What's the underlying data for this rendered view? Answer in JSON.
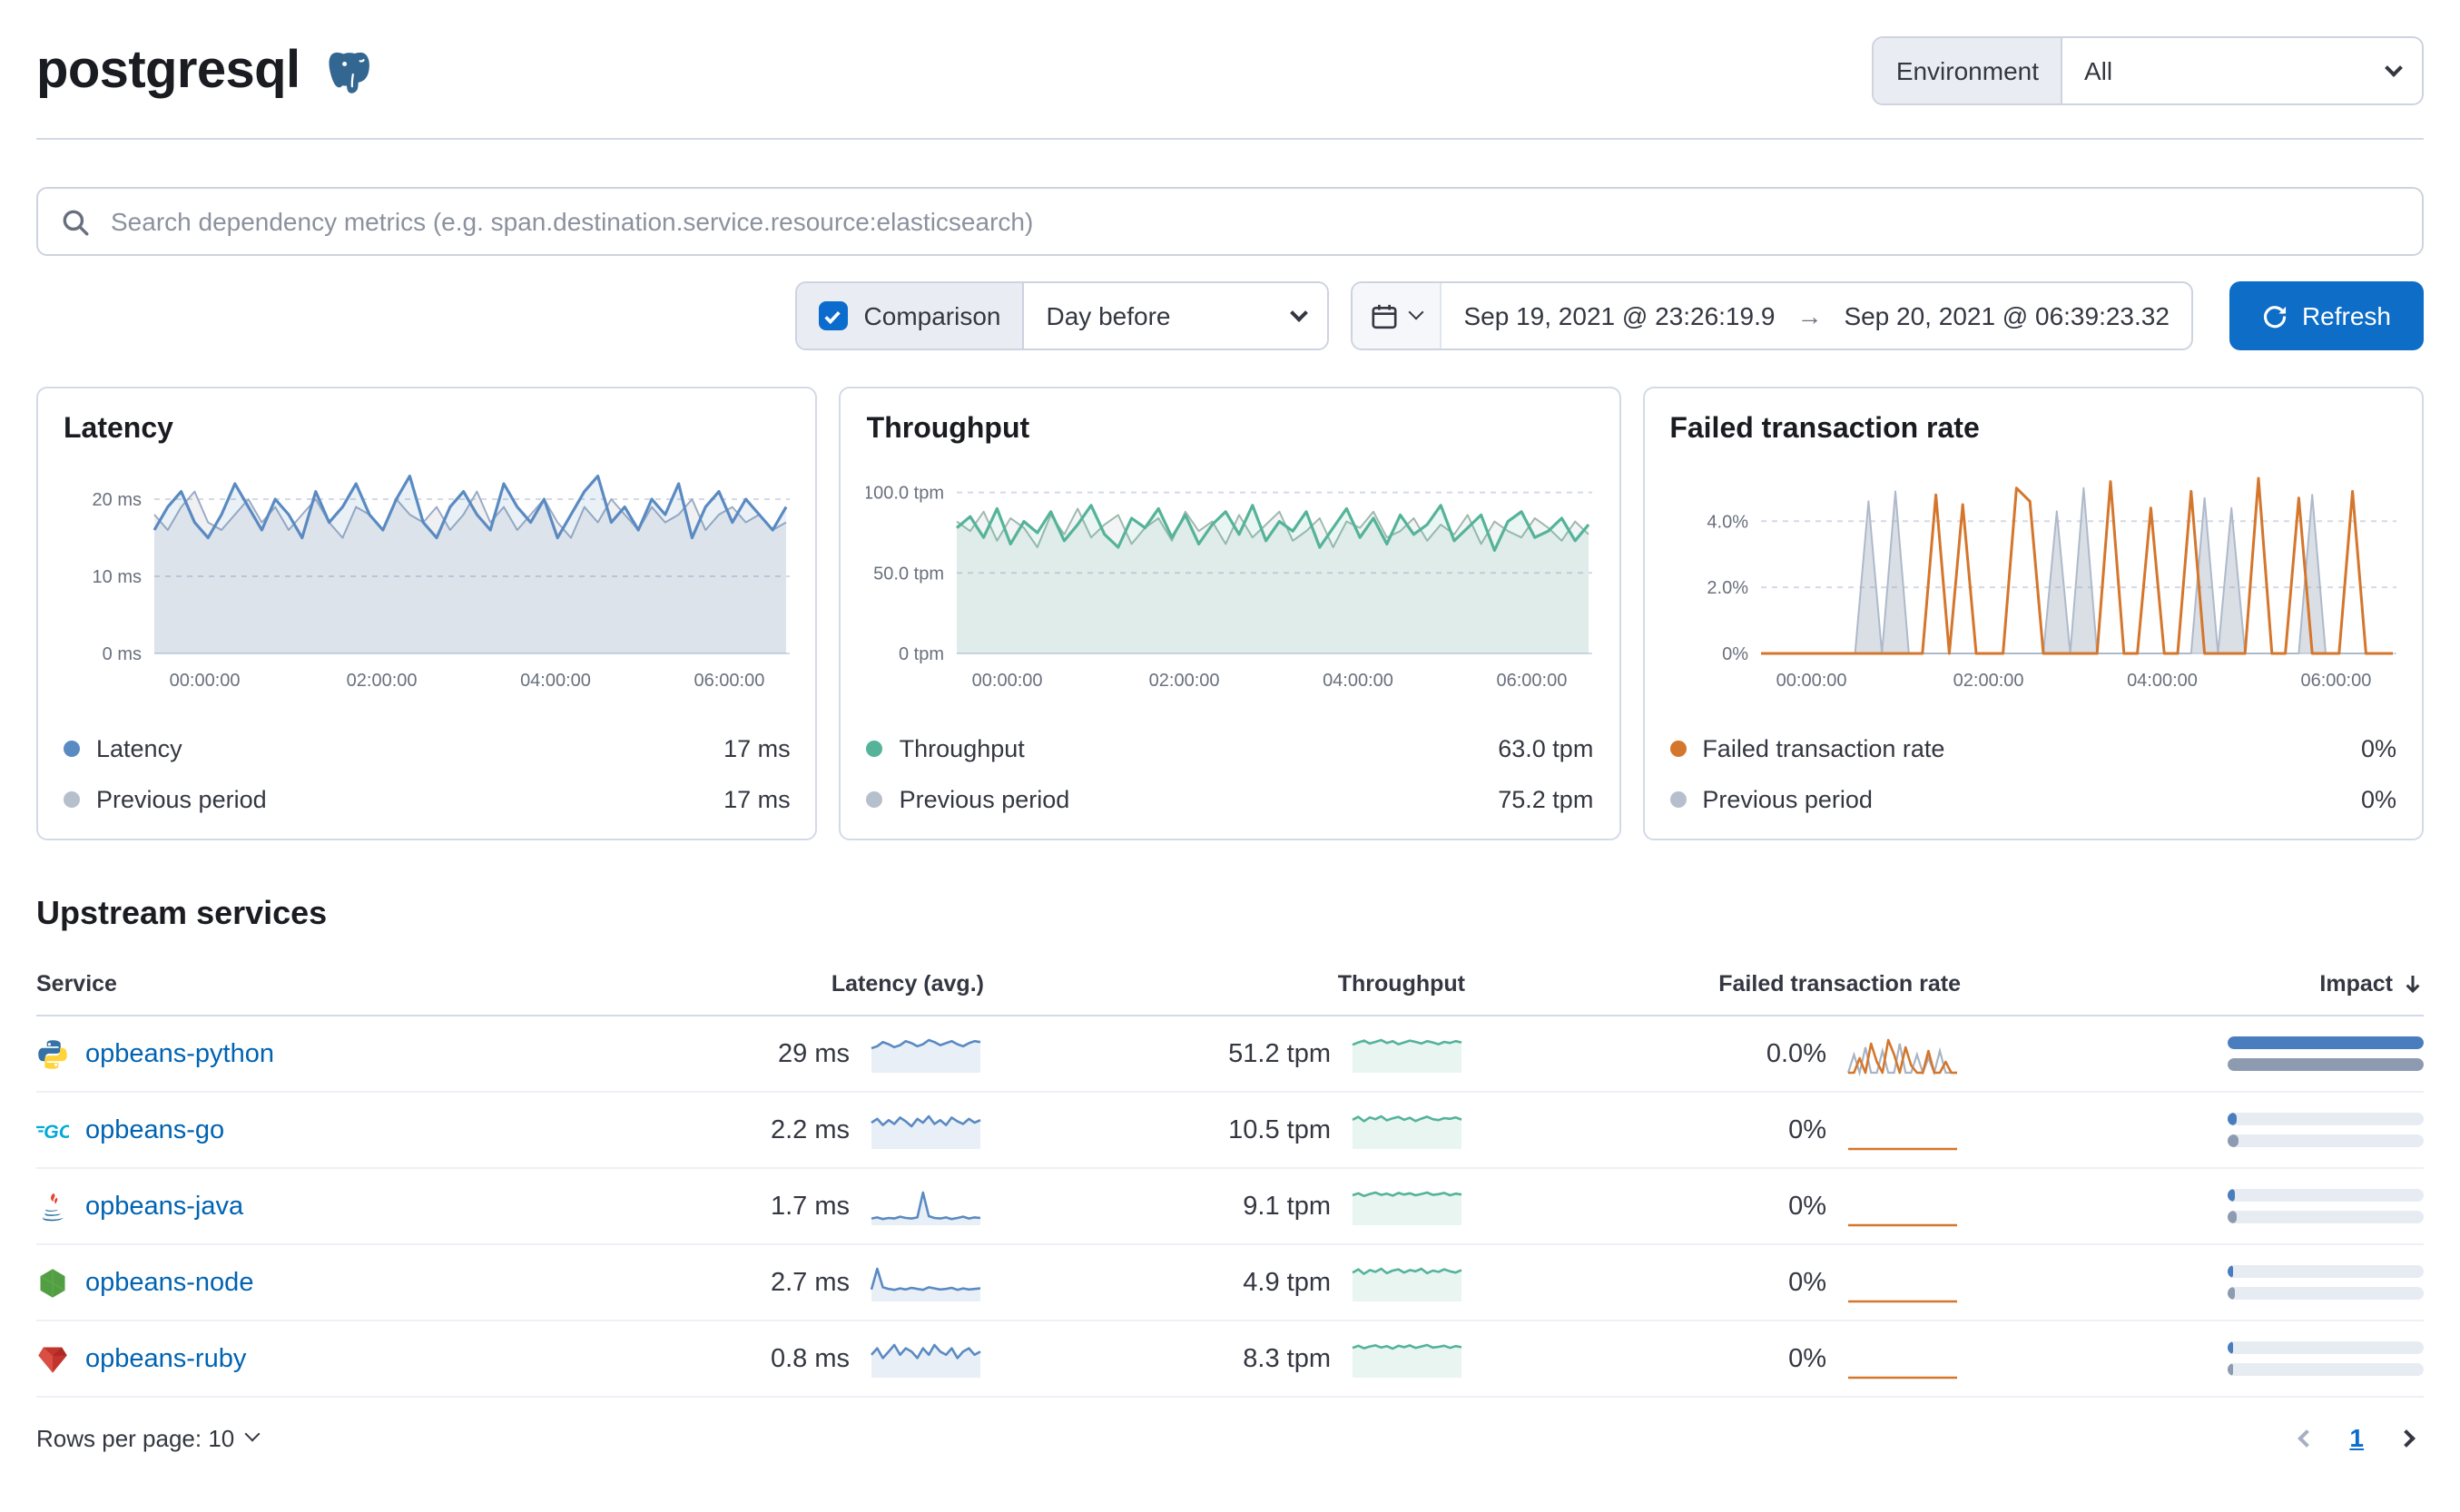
{
  "colors": {
    "accent": "#0b6cce",
    "link": "#0063b2",
    "latency": "#5a8ac2",
    "throughput": "#54b399",
    "failed": "#d4762c",
    "previous": "#a9b4c4",
    "impact_current": "#4a7dbd",
    "impact_previous": "#8d9bb1",
    "impact_track": "#e7ecf3"
  },
  "page": {
    "title": "postgresql"
  },
  "header": {
    "environment_label": "Environment",
    "environment_value": "All"
  },
  "search": {
    "placeholder": "Search dependency metrics (e.g. span.destination.service.resource:elasticsearch)"
  },
  "controls": {
    "comparison_label": "Comparison",
    "comparison_checked": true,
    "comparison_option": "Day before",
    "date_start": "Sep 19, 2021 @ 23:26:19.9",
    "date_end": "Sep 20, 2021 @ 06:39:23.32",
    "refresh_label": "Refresh"
  },
  "chart_data": [
    {
      "type": "line",
      "title": "Latency",
      "x_tick_labels": [
        "00:00:00",
        "02:00:00",
        "04:00:00",
        "06:00:00"
      ],
      "y": {
        "max": 24,
        "ticks": [
          {
            "value": 20,
            "label": "20 ms"
          },
          {
            "value": 10,
            "label": "10 ms"
          },
          {
            "value": 0,
            "label": "0 ms"
          }
        ]
      },
      "series": [
        {
          "name": "Latency",
          "color": "#5a8ac2",
          "width": 1.6,
          "fill": "rgba(96,146,192,0.14)",
          "values": [
            16,
            19,
            21,
            17,
            15,
            18,
            22,
            19,
            16,
            20,
            18,
            15,
            21,
            17,
            19,
            22,
            18,
            16,
            20,
            23,
            17,
            15,
            19,
            21,
            18,
            16,
            22,
            19,
            17,
            20,
            15,
            18,
            21,
            23,
            17,
            19,
            16,
            20,
            18,
            22,
            15,
            19,
            21,
            17,
            20,
            18,
            16,
            19
          ]
        },
        {
          "name": "Previous period",
          "color": "#9aabc4",
          "width": 1,
          "fill": "rgba(105,112,125,0.10)",
          "values": [
            18,
            16,
            19,
            21,
            17,
            16,
            18,
            20,
            17,
            19,
            16,
            18,
            20,
            17,
            15,
            19,
            18,
            16,
            20,
            18,
            17,
            19,
            16,
            18,
            21,
            17,
            19,
            16,
            18,
            20,
            17,
            15,
            19,
            17,
            20,
            18,
            16,
            19,
            17,
            18,
            20,
            16,
            18,
            19,
            17,
            18,
            16,
            17
          ]
        }
      ],
      "legend": [
        {
          "label": "Latency",
          "value": "17 ms",
          "color": "#5a8ac2"
        },
        {
          "label": "Previous period",
          "value": "17 ms",
          "color": "#b6bfcc"
        }
      ]
    },
    {
      "type": "line",
      "title": "Throughput",
      "x_tick_labels": [
        "00:00:00",
        "02:00:00",
        "04:00:00",
        "06:00:00"
      ],
      "y": {
        "max": 115,
        "ticks": [
          {
            "value": 100,
            "label": "100.0 tpm"
          },
          {
            "value": 50,
            "label": "50.0 tpm"
          },
          {
            "value": 0,
            "label": "0 tpm"
          }
        ]
      },
      "series": [
        {
          "name": "Throughput",
          "color": "#54b399",
          "width": 1.6,
          "fill": "rgba(84,179,153,0.12)",
          "values": [
            78,
            85,
            72,
            90,
            68,
            82,
            75,
            88,
            70,
            80,
            92,
            74,
            66,
            84,
            78,
            90,
            72,
            86,
            68,
            80,
            88,
            74,
            92,
            70,
            82,
            76,
            88,
            66,
            78,
            90,
            72,
            84,
            68,
            86,
            74,
            80,
            92,
            70,
            78,
            86,
            64,
            82,
            88,
            72,
            76,
            84,
            70,
            80
          ]
        },
        {
          "name": "Previous period",
          "color": "#9fb9ae",
          "width": 1,
          "fill": "rgba(105,112,125,0.08)",
          "values": [
            82,
            76,
            88,
            70,
            84,
            78,
            66,
            86,
            74,
            90,
            72,
            80,
            86,
            68,
            78,
            84,
            70,
            88,
            76,
            82,
            68,
            86,
            72,
            80,
            88,
            70,
            76,
            84,
            66,
            82,
            78,
            88,
            72,
            76,
            84,
            70,
            80,
            74,
            86,
            68,
            82,
            76,
            72,
            84,
            78,
            70,
            82,
            74
          ]
        }
      ],
      "legend": [
        {
          "label": "Throughput",
          "value": "63.0 tpm",
          "color": "#54b399"
        },
        {
          "label": "Previous period",
          "value": "75.2 tpm",
          "color": "#b6bfcc"
        }
      ]
    },
    {
      "type": "line",
      "title": "Failed transaction rate",
      "x_tick_labels": [
        "00:00:00",
        "02:00:00",
        "04:00:00",
        "06:00:00"
      ],
      "y": {
        "max": 5.6,
        "ticks": [
          {
            "value": 4,
            "label": "4.0%"
          },
          {
            "value": 2,
            "label": "2.0%"
          },
          {
            "value": 0,
            "label": "0%"
          }
        ]
      },
      "series": [
        {
          "name": "Failed transaction rate",
          "color": "#d4762c",
          "width": 1.5,
          "fill": null,
          "values": [
            0,
            0,
            0,
            0,
            0,
            0,
            0,
            0,
            0,
            0,
            0,
            0,
            0,
            4.8,
            0,
            4.5,
            0,
            0,
            0,
            5.0,
            4.6,
            0,
            0,
            0,
            0,
            0,
            5.2,
            0,
            0,
            4.4,
            0,
            0,
            4.9,
            0,
            0,
            0,
            0,
            5.3,
            0,
            0,
            4.7,
            0,
            0,
            0,
            4.9,
            0,
            0,
            0
          ]
        },
        {
          "name": "Previous period",
          "color": "#aeb9ca",
          "width": 1,
          "fill": "rgba(150,163,184,0.35)",
          "values": [
            0,
            0,
            0,
            0,
            0,
            0,
            0,
            0,
            4.6,
            0,
            4.9,
            0,
            0,
            0,
            0,
            0,
            0,
            0,
            0,
            0,
            0,
            0,
            4.3,
            0,
            5.0,
            0,
            0,
            0,
            0,
            0,
            0,
            0,
            0,
            4.7,
            0,
            4.4,
            0,
            0,
            0,
            0,
            0,
            4.8,
            0,
            0,
            0,
            0,
            0,
            0
          ]
        }
      ],
      "legend": [
        {
          "label": "Failed transaction rate",
          "value": "0%",
          "color": "#d4762c"
        },
        {
          "label": "Previous period",
          "value": "0%",
          "color": "#b6bfcc"
        }
      ]
    }
  ],
  "upstream": {
    "heading": "Upstream services",
    "columns": [
      "Service",
      "Latency (avg.)",
      "Throughput",
      "Failed transaction rate",
      "Impact"
    ],
    "rows": [
      {
        "service": "opbeans-python",
        "icon": "python",
        "latency": "29 ms",
        "throughput": "51.2 tpm",
        "failed_rate": "0.0%",
        "spark_latency": [
          24,
          26,
          30,
          28,
          25,
          27,
          31,
          29,
          26,
          28,
          32,
          30,
          27,
          29,
          31,
          28,
          26,
          29,
          31,
          30
        ],
        "spark_throughput": [
          48,
          52,
          55,
          50,
          53,
          56,
          51,
          54,
          49,
          52,
          55,
          53,
          50,
          54,
          52,
          49,
          53,
          51,
          54,
          52
        ],
        "spark_failed": [
          0,
          0,
          0.4,
          0,
          0.8,
          0.3,
          0,
          0.9,
          0.5,
          0,
          0.7,
          0.2,
          0,
          0,
          0.6,
          0,
          0,
          0.3,
          0,
          0
        ],
        "spark_failed_prev": [
          0,
          0.5,
          0,
          0.7,
          0,
          0,
          0.6,
          0,
          0,
          0.8,
          0,
          0,
          0.5,
          0,
          0.4,
          0,
          0.6,
          0,
          0,
          0
        ],
        "impact": {
          "current": 1.0,
          "previous": 1.0
        }
      },
      {
        "service": "opbeans-go",
        "icon": "go",
        "latency": "2.2 ms",
        "throughput": "10.5 tpm",
        "failed_rate": "0%",
        "spark_latency": [
          2.1,
          2.4,
          1.9,
          2.3,
          2.0,
          2.5,
          2.2,
          1.8,
          2.4,
          2.1,
          2.6,
          2.0,
          2.3,
          1.9,
          2.5,
          2.2,
          2.0,
          2.4,
          2.1,
          2.3
        ],
        "spark_throughput": [
          10,
          11,
          9.5,
          10.8,
          10.2,
          11.2,
          9.8,
          10.5,
          11,
          10,
          10.7,
          9.6,
          10.4,
          11.1,
          10.2,
          9.9,
          10.6,
          10.3,
          10.8,
          10.1
        ],
        "spark_failed": [
          0,
          0,
          0,
          0,
          0,
          0,
          0,
          0,
          0,
          0,
          0,
          0,
          0,
          0,
          0,
          0,
          0,
          0,
          0,
          0
        ],
        "impact": {
          "current": 0.05,
          "previous": 0.06
        }
      },
      {
        "service": "opbeans-java",
        "icon": "java",
        "latency": "1.7 ms",
        "throughput": "9.1 tpm",
        "failed_rate": "0%",
        "spark_latency": [
          1.2,
          1.4,
          1.1,
          1.3,
          1.2,
          1.5,
          1.3,
          1.2,
          1.4,
          5.8,
          1.6,
          1.3,
          1.2,
          1.4,
          1.1,
          1.3,
          1.5,
          1.2,
          1.4,
          1.3
        ],
        "spark_throughput": [
          8.8,
          9.4,
          8.6,
          9.2,
          9.6,
          8.9,
          9.3,
          8.7,
          9.5,
          9.0,
          9.4,
          8.8,
          9.2,
          9.6,
          8.9,
          9.1,
          9.5,
          8.8,
          9.3,
          9.0
        ],
        "spark_failed": [
          0,
          0,
          0,
          0,
          0,
          0,
          0,
          0,
          0,
          0,
          0,
          0,
          0,
          0,
          0,
          0,
          0,
          0,
          0,
          0
        ],
        "impact": {
          "current": 0.04,
          "previous": 0.05
        }
      },
      {
        "service": "opbeans-node",
        "icon": "node",
        "latency": "2.7 ms",
        "throughput": "4.9 tpm",
        "failed_rate": "0%",
        "spark_latency": [
          2.4,
          6.5,
          2.8,
          2.5,
          2.3,
          2.6,
          2.4,
          2.7,
          2.5,
          2.3,
          2.8,
          2.6,
          2.4,
          2.5,
          2.7,
          2.3,
          2.6,
          2.4,
          2.5,
          2.6
        ],
        "spark_throughput": [
          4.6,
          5.1,
          4.4,
          5.0,
          4.7,
          5.2,
          4.5,
          4.9,
          5.1,
          4.6,
          5.0,
          4.8,
          5.2,
          4.5,
          4.9,
          4.7,
          5.1,
          4.8,
          4.6,
          5.0
        ],
        "spark_failed": [
          0,
          0,
          0,
          0,
          0,
          0,
          0,
          0,
          0,
          0,
          0,
          0,
          0,
          0,
          0,
          0,
          0,
          0,
          0,
          0
        ],
        "impact": {
          "current": 0.03,
          "previous": 0.04
        }
      },
      {
        "service": "opbeans-ruby",
        "icon": "ruby",
        "latency": "0.8 ms",
        "throughput": "8.3 tpm",
        "failed_rate": "0%",
        "spark_latency": [
          0.7,
          0.9,
          0.6,
          0.8,
          1.0,
          0.7,
          0.9,
          0.8,
          0.6,
          0.9,
          0.7,
          1.0,
          0.8,
          0.7,
          0.9,
          0.6,
          0.8,
          0.9,
          0.7,
          0.8
        ],
        "spark_throughput": [
          8.0,
          8.6,
          7.9,
          8.4,
          8.7,
          8.1,
          8.5,
          7.8,
          8.6,
          8.2,
          8.7,
          8.0,
          8.4,
          8.8,
          8.1,
          8.3,
          8.6,
          8.0,
          8.5,
          8.2
        ],
        "spark_failed": [
          0,
          0,
          0,
          0,
          0,
          0,
          0,
          0,
          0,
          0,
          0,
          0,
          0,
          0,
          0,
          0,
          0,
          0,
          0,
          0
        ],
        "impact": {
          "current": 0.03,
          "previous": 0.03
        }
      }
    ],
    "footer": {
      "rows_per_page_label": "Rows per page: 10",
      "page": "1"
    }
  }
}
